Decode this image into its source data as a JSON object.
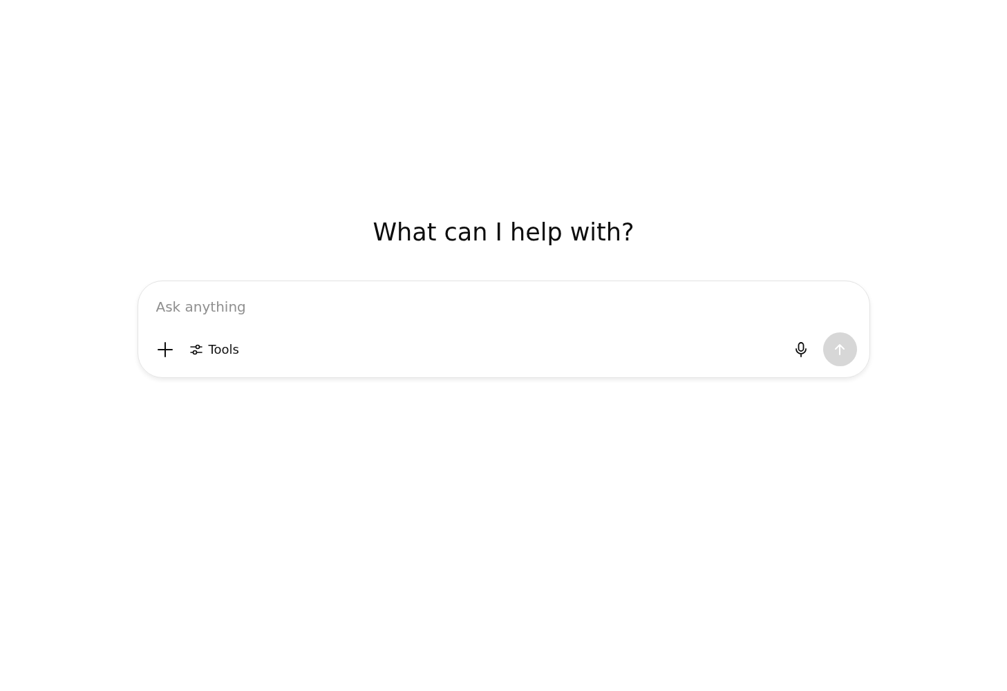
{
  "heading": "What can I help with?",
  "composer": {
    "placeholder": "Ask anything",
    "tools_label": "Tools",
    "send_disabled": true
  }
}
